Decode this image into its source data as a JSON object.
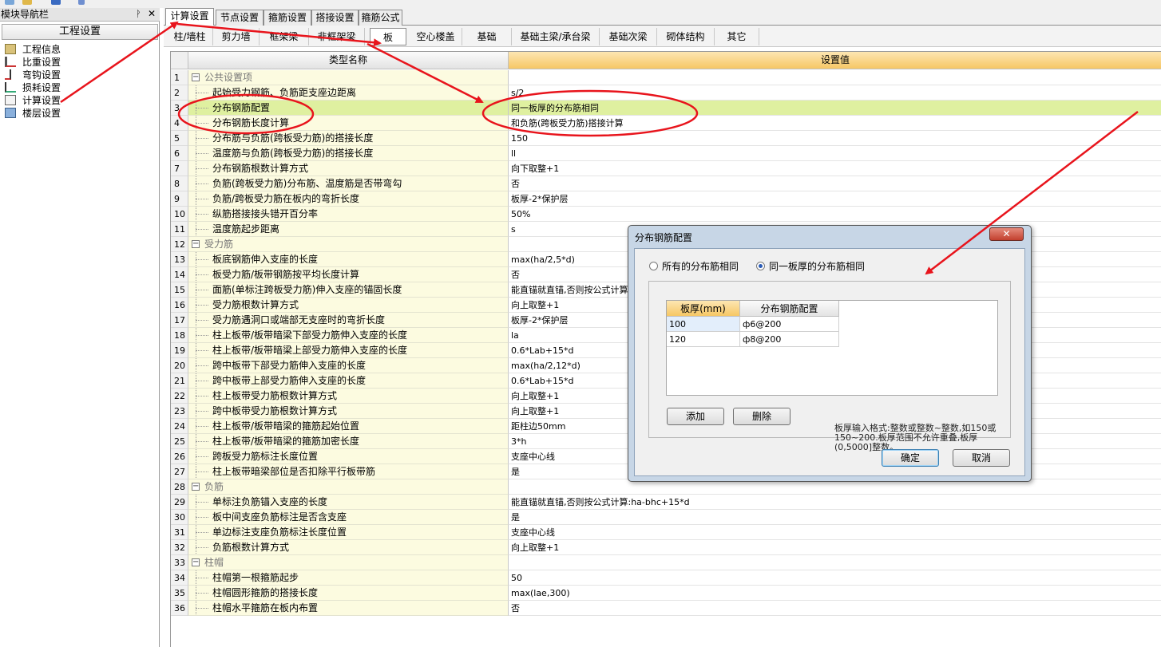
{
  "nav": {
    "title": "模块导航栏",
    "pin_glyph": "ᚹ",
    "close_glyph": "✕",
    "group": "工程设置",
    "items": [
      {
        "label": "工程信息",
        "icon": "project-info-icon"
      },
      {
        "label": "比重设置",
        "icon": "weight-icon"
      },
      {
        "label": "弯钩设置",
        "icon": "hook-icon"
      },
      {
        "label": "损耗设置",
        "icon": "loss-icon"
      },
      {
        "label": "计算设置",
        "icon": "calc-icon"
      },
      {
        "label": "楼层设置",
        "icon": "floor-icon"
      }
    ]
  },
  "tabs": [
    "计算设置",
    "节点设置",
    "箍筋设置",
    "搭接设置",
    "箍筋公式"
  ],
  "subtabs": [
    "柱/墙柱",
    "剪力墙",
    "框架梁",
    "非框架梁",
    "板",
    "空心楼盖",
    "基础",
    "基础主梁/承台梁",
    "基础次梁",
    "砌体结构",
    "其它"
  ],
  "grid": {
    "col_name": "类型名称",
    "col_value": "设置值",
    "rows": [
      {
        "n": "1",
        "name": "公共设置项",
        "value": "",
        "group": true
      },
      {
        "n": "2",
        "name": "起始受力钢筋、负筋距支座边距离",
        "value": "s/2"
      },
      {
        "n": "3",
        "name": "分布钢筋配置",
        "value": "同一板厚的分布筋相同",
        "sel": true
      },
      {
        "n": "4",
        "name": "分布钢筋长度计算",
        "value": "和负筋(跨板受力筋)搭接计算"
      },
      {
        "n": "5",
        "name": "分布筋与负筋(跨板受力筋)的搭接长度",
        "value": "150"
      },
      {
        "n": "6",
        "name": "温度筋与负筋(跨板受力筋)的搭接长度",
        "value": "ll"
      },
      {
        "n": "7",
        "name": "分布钢筋根数计算方式",
        "value": "向下取整+1"
      },
      {
        "n": "8",
        "name": "负筋(跨板受力筋)分布筋、温度筋是否带弯勾",
        "value": "否"
      },
      {
        "n": "9",
        "name": "负筋/跨板受力筋在板内的弯折长度",
        "value": "板厚-2*保护层"
      },
      {
        "n": "10",
        "name": "纵筋搭接接头错开百分率",
        "value": "50%"
      },
      {
        "n": "11",
        "name": "温度筋起步距离",
        "value": "s"
      },
      {
        "n": "12",
        "name": "受力筋",
        "value": "",
        "group": true
      },
      {
        "n": "13",
        "name": "板底钢筋伸入支座的长度",
        "value": "max(ha/2,5*d)"
      },
      {
        "n": "14",
        "name": "板受力筋/板带钢筋按平均长度计算",
        "value": "否"
      },
      {
        "n": "15",
        "name": "面筋(单标注跨板受力筋)伸入支座的锚固长度",
        "value": "能直锚就直锚,否则按公式计算:ha-bhc+15*d"
      },
      {
        "n": "16",
        "name": "受力筋根数计算方式",
        "value": "向上取整+1"
      },
      {
        "n": "17",
        "name": "受力筋遇洞口或端部无支座时的弯折长度",
        "value": "板厚-2*保护层"
      },
      {
        "n": "18",
        "name": "柱上板带/板带暗梁下部受力筋伸入支座的长度",
        "value": "la"
      },
      {
        "n": "19",
        "name": "柱上板带/板带暗梁上部受力筋伸入支座的长度",
        "value": "0.6*Lab+15*d"
      },
      {
        "n": "20",
        "name": "跨中板带下部受力筋伸入支座的长度",
        "value": "max(ha/2,12*d)"
      },
      {
        "n": "21",
        "name": "跨中板带上部受力筋伸入支座的长度",
        "value": "0.6*Lab+15*d"
      },
      {
        "n": "22",
        "name": "柱上板带受力筋根数计算方式",
        "value": "向上取整+1"
      },
      {
        "n": "23",
        "name": "跨中板带受力筋根数计算方式",
        "value": "向上取整+1"
      },
      {
        "n": "24",
        "name": "柱上板带/板带暗梁的箍筋起始位置",
        "value": "距柱边50mm"
      },
      {
        "n": "25",
        "name": "柱上板带/板带暗梁的箍筋加密长度",
        "value": "3*h"
      },
      {
        "n": "26",
        "name": "跨板受力筋标注长度位置",
        "value": "支座中心线"
      },
      {
        "n": "27",
        "name": "柱上板带暗梁部位是否扣除平行板带筋",
        "value": "是"
      },
      {
        "n": "28",
        "name": "负筋",
        "value": "",
        "group": true
      },
      {
        "n": "29",
        "name": "单标注负筋锚入支座的长度",
        "value": "能直锚就直锚,否则按公式计算:ha-bhc+15*d"
      },
      {
        "n": "30",
        "name": "板中间支座负筋标注是否含支座",
        "value": "是"
      },
      {
        "n": "31",
        "name": "单边标注支座负筋标注长度位置",
        "value": "支座中心线"
      },
      {
        "n": "32",
        "name": "负筋根数计算方式",
        "value": "向上取整+1"
      },
      {
        "n": "33",
        "name": "柱帽",
        "value": "",
        "group": true
      },
      {
        "n": "34",
        "name": "柱帽第一根箍筋起步",
        "value": "50"
      },
      {
        "n": "35",
        "name": "柱帽圆形箍筋的搭接长度",
        "value": "max(lae,300)"
      },
      {
        "n": "36",
        "name": "柱帽水平箍筋在板内布置",
        "value": "否"
      }
    ]
  },
  "dialog": {
    "title": "分布钢筋配置",
    "close_glyph": "✕",
    "radio_all": "所有的分布筋相同",
    "radio_same": "同一板厚的分布筋相同",
    "selected": "radio_same",
    "col_thickness": "板厚(mm)",
    "col_config": "分布钢筋配置",
    "rows": [
      {
        "thickness": "100",
        "config": "ф6@200"
      },
      {
        "thickness": "120",
        "config": "ф8@200"
      }
    ],
    "add": "添加",
    "delete": "删除",
    "hint": "板厚输入格式:整数或整数~整数,如150或150~200.板厚范围不允许重叠,板厚(0,5000]整数。",
    "ok": "确定",
    "cancel": "取消"
  },
  "colors": {
    "annotation": "#e8141c",
    "selected_row": "#dff0a0",
    "name_column": "#fcfbe0",
    "header_orange": "#f6c765"
  }
}
